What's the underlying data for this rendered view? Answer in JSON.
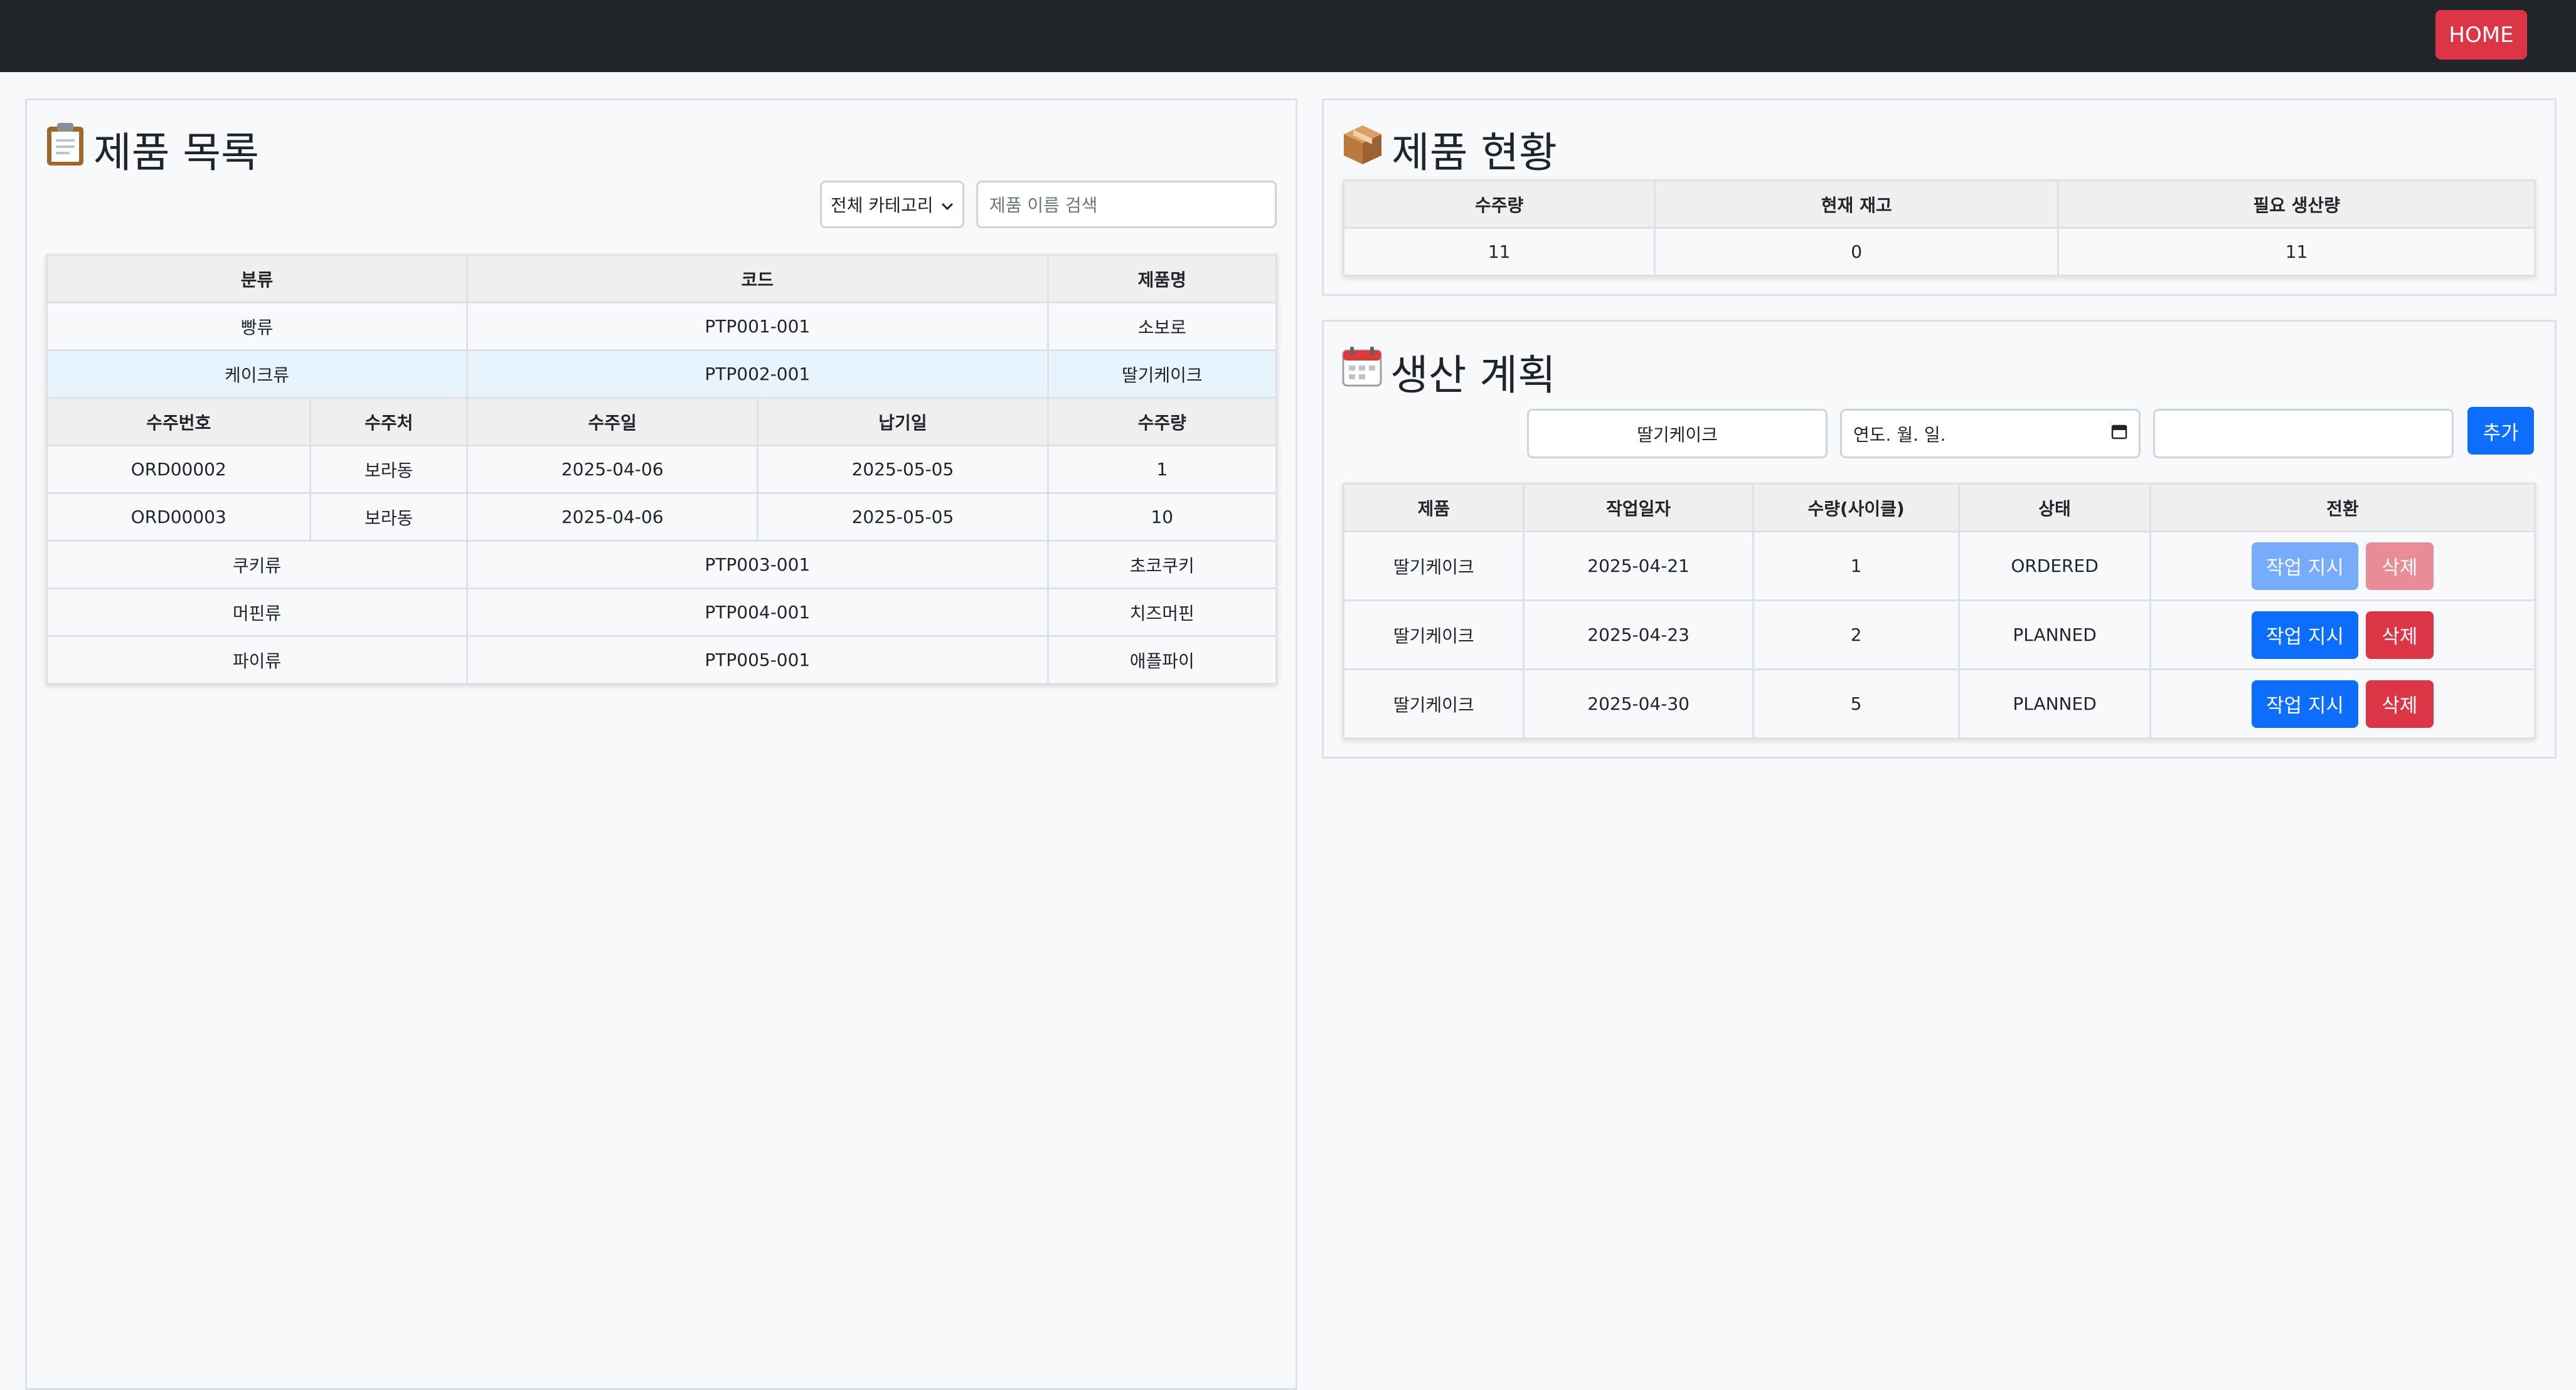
{
  "nav": {
    "home_label": "HOME"
  },
  "product_list": {
    "title": "제품 목록",
    "category_select": "전체 카테고리",
    "search_placeholder": "제품 이름 검색",
    "headers": [
      "분류",
      "코드",
      "제품명"
    ],
    "rows": [
      {
        "category": "빵류",
        "code": "PTP001-001",
        "name": "소보로"
      },
      {
        "category": "케이크류",
        "code": "PTP002-001",
        "name": "딸기케이크"
      },
      {
        "category": "쿠키류",
        "code": "PTP003-001",
        "name": "초코쿠키"
      },
      {
        "category": "머핀류",
        "code": "PTP004-001",
        "name": "치즈머핀"
      },
      {
        "category": "파이류",
        "code": "PTP005-001",
        "name": "애플파이"
      }
    ],
    "order_headers": [
      "수주번호",
      "수주처",
      "수주일",
      "납기일",
      "수주량"
    ],
    "orders": [
      {
        "no": "ORD00002",
        "client": "보라동",
        "order_date": "2025-04-06",
        "due_date": "2025-05-05",
        "qty": "1"
      },
      {
        "no": "ORD00003",
        "client": "보라동",
        "order_date": "2025-04-06",
        "due_date": "2025-05-05",
        "qty": "10"
      }
    ]
  },
  "product_status": {
    "title": "제품 현황",
    "headers": [
      "수주량",
      "현재 재고",
      "필요 생산량"
    ],
    "values": [
      "11",
      "0",
      "11"
    ]
  },
  "production_plan": {
    "title": "생산 계획",
    "product_input": "딸기케이크",
    "date_input_placeholder": "연도. 월. 일.",
    "qty_input": "",
    "add_label": "추가",
    "headers": [
      "제품",
      "작업일자",
      "수량(사이클)",
      "상태",
      "전환"
    ],
    "rows": [
      {
        "product": "딸기케이크",
        "date": "2025-04-21",
        "qty": "1",
        "status": "ORDERED"
      },
      {
        "product": "딸기케이크",
        "date": "2025-04-23",
        "qty": "2",
        "status": "PLANNED"
      },
      {
        "product": "딸기케이크",
        "date": "2025-04-30",
        "qty": "5",
        "status": "PLANNED"
      }
    ],
    "instruct_label": "작업 지시",
    "delete_label": "삭제"
  },
  "icons": {
    "clipboard": "clipboard-icon",
    "package": "package-icon",
    "calendar": "calendar-icon"
  }
}
